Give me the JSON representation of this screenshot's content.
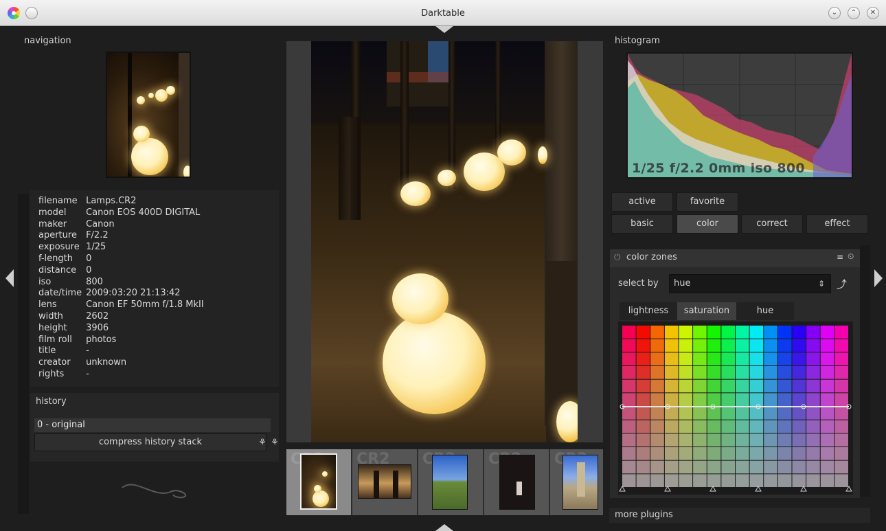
{
  "window": {
    "title": "Darktable",
    "controls": [
      "chevron-down",
      "chevron-up",
      "close"
    ]
  },
  "left_panel": {
    "navigation_label": "navigation",
    "image_info": [
      {
        "key": "filename",
        "value": "Lamps.CR2"
      },
      {
        "key": "model",
        "value": "Canon EOS 400D DIGITAL"
      },
      {
        "key": "maker",
        "value": "Canon"
      },
      {
        "key": "aperture",
        "value": "F/2.2"
      },
      {
        "key": "exposure",
        "value": "1/25"
      },
      {
        "key": "f-length",
        "value": "0"
      },
      {
        "key": "distance",
        "value": "0"
      },
      {
        "key": "iso",
        "value": "800"
      },
      {
        "key": "date/time",
        "value": "2009:03:20 21:13:42"
      },
      {
        "key": "lens",
        "value": "Canon EF 50mm f/1.8 MkII"
      },
      {
        "key": "width",
        "value": "2602"
      },
      {
        "key": "height",
        "value": "3906"
      },
      {
        "key": "film roll",
        "value": "photos"
      },
      {
        "key": "title",
        "value": "-"
      },
      {
        "key": "creator",
        "value": "unknown"
      },
      {
        "key": "rights",
        "value": "-"
      }
    ],
    "history": {
      "label": "history",
      "items": [
        "0 - original"
      ],
      "compress_label": "compress history stack"
    }
  },
  "filmstrip": {
    "cells": [
      {
        "ext": "CR2",
        "active": true
      },
      {
        "ext": "CR2",
        "active": false
      },
      {
        "ext": "CR2",
        "active": false
      },
      {
        "ext": "CR2",
        "active": false
      },
      {
        "ext": "CR2",
        "active": false
      }
    ]
  },
  "right_panel": {
    "histogram_label": "histogram",
    "histogram_info": "1/25 f/2.2 0mm iso 800",
    "group_buttons_row1": [
      "active",
      "favorite"
    ],
    "group_buttons_row2": [
      "basic",
      "color",
      "correct",
      "effect"
    ],
    "selected_group": "color",
    "module": {
      "name": "color zones",
      "select_by_label": "select by",
      "select_by_value": "hue",
      "tabs": [
        "lightness",
        "saturation",
        "hue"
      ],
      "active_tab": "saturation"
    },
    "more_plugins": "more plugins"
  }
}
